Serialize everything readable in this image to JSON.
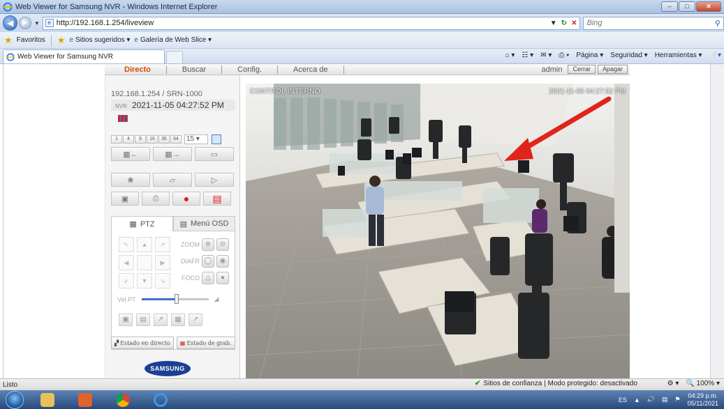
{
  "window": {
    "title": "Web Viewer for Samsung NVR - Windows Internet Explorer"
  },
  "address": {
    "url": "http://192.168.1.254/liveview",
    "search_placeholder": "Bing"
  },
  "favorites": {
    "label": "Favoritos",
    "items": [
      "Sitios sugeridos ▾",
      "Galería de Web Slice ▾"
    ]
  },
  "tab": {
    "title": "Web Viewer for Samsung NVR"
  },
  "commandbar": {
    "items": [
      "Página ▾",
      "Seguridad ▾",
      "Herramientas ▾"
    ]
  },
  "appnav": {
    "items": [
      "Directo",
      "Buscar",
      "Config.",
      "Acerca de"
    ],
    "user": "admin",
    "logout": "Cerrar",
    "shutdown": "Apagar"
  },
  "device": {
    "info": "192.168.1.254 / SRN-1000",
    "nvr_label": "NVR",
    "timestamp": "2021-11-05 04:27:52 PM"
  },
  "split": {
    "options": [
      "1",
      "4",
      "9",
      "16",
      "36",
      "64"
    ],
    "selected": "15"
  },
  "ptz": {
    "tab_ptz": "PTZ",
    "tab_osd": "Menú OSD",
    "zoom": "ZOOM",
    "iris": "DIAFR",
    "focus": "FOCO",
    "speed": "Vel.PT"
  },
  "status_buttons": {
    "live": "Estado en directo",
    "rec": "Estado de grab."
  },
  "brand": "SAMSUNG",
  "camera": {
    "label": "CONTROL INTERNO",
    "timestamp": "2021-11-05 04:27:52 PM"
  },
  "statusbar": {
    "left": "Listo",
    "zone": "Sitios de confianza | Modo protegido: desactivado",
    "zoom": "100%"
  },
  "taskbar": {
    "lang": "ES",
    "time": "04:29 p.m.",
    "date": "05/11/2021"
  },
  "colors": {
    "accent_nav": "#d84a00",
    "annotation_arrow": "#e0241a",
    "brand": "#1b3f94"
  }
}
